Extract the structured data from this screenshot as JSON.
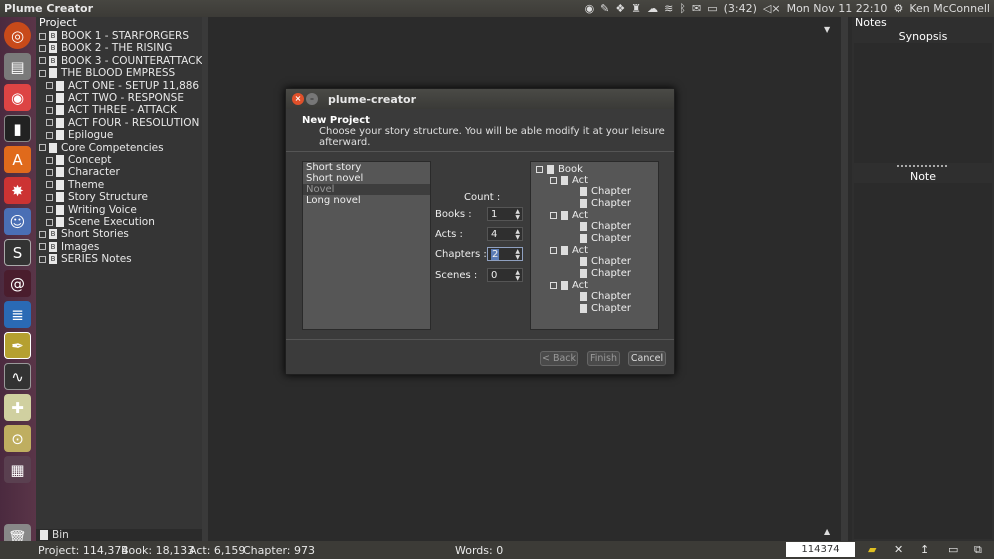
{
  "app_title": "Plume Creator",
  "tray": {
    "battery": "(3:42)",
    "datetime": "Mon Nov 11  22:10",
    "user": "Ken McConnell"
  },
  "project_panel": {
    "header": "Project",
    "items": [
      {
        "label": "BOOK 1 - STARFORGERS",
        "icon": "B",
        "indent": 0
      },
      {
        "label": "BOOK 2 - THE RISING",
        "icon": "B",
        "indent": 0
      },
      {
        "label": "BOOK 3 - COUNTERATTACK",
        "icon": "B",
        "indent": 0
      },
      {
        "label": "THE BLOOD EMPRESS",
        "icon": "book",
        "indent": 0
      },
      {
        "label": "ACT ONE - SETUP 11,886",
        "icon": "act",
        "indent": 1
      },
      {
        "label": "ACT TWO - RESPONSE",
        "icon": "act",
        "indent": 1
      },
      {
        "label": "ACT THREE - ATTACK",
        "icon": "act",
        "indent": 1
      },
      {
        "label": "ACT FOUR - RESOLUTION",
        "icon": "act",
        "indent": 1
      },
      {
        "label": "Epilogue",
        "icon": "act",
        "indent": 1
      },
      {
        "label": "Core Competencies",
        "icon": "book",
        "indent": 0
      },
      {
        "label": "Concept",
        "icon": "act",
        "indent": 1
      },
      {
        "label": "Character",
        "icon": "act",
        "indent": 1
      },
      {
        "label": "Theme",
        "icon": "act",
        "indent": 1
      },
      {
        "label": "Story Structure",
        "icon": "act",
        "indent": 1
      },
      {
        "label": "Writing Voice",
        "icon": "act",
        "indent": 1
      },
      {
        "label": "Scene Execution",
        "icon": "act",
        "indent": 1
      },
      {
        "label": "Short Stories",
        "icon": "B",
        "indent": 0
      },
      {
        "label": "Images",
        "icon": "B",
        "indent": 0
      },
      {
        "label": "SERIES Notes",
        "icon": "B",
        "indent": 0
      }
    ],
    "bin": "Bin"
  },
  "notes_panel": {
    "header": "Notes",
    "synopsis": "Synopsis",
    "note": "Note"
  },
  "status": {
    "project": "Project: 114,374",
    "book": "Book: 18,133",
    "act": "Act: 6,159",
    "chapter": "Chapter: 973",
    "words": "Words: 0",
    "counter": "114374"
  },
  "dialog": {
    "title": "plume-creator",
    "heading": "New Project",
    "subtext": "Choose your story structure. You will be able modify it at your leisure afterward.",
    "structures": [
      "Short story",
      "Short novel",
      "Novel",
      "Long novel"
    ],
    "selected_structure": "Novel",
    "count_label": "Count :",
    "fields": [
      {
        "label": "Books :",
        "value": "1"
      },
      {
        "label": "Acts :",
        "value": "4"
      },
      {
        "label": "Chapters :",
        "value": "2"
      },
      {
        "label": "Scenes :",
        "value": "0"
      }
    ],
    "preview": {
      "book": "Book",
      "acts": [
        {
          "label": "Act",
          "chapters": [
            "Chapter",
            "Chapter"
          ]
        },
        {
          "label": "Act",
          "chapters": [
            "Chapter",
            "Chapter"
          ]
        },
        {
          "label": "Act",
          "chapters": [
            "Chapter",
            "Chapter"
          ]
        },
        {
          "label": "Act",
          "chapters": [
            "Chapter",
            "Chapter"
          ]
        }
      ]
    },
    "buttons": {
      "back": "< Back",
      "finish": "Finish",
      "cancel": "Cancel"
    }
  }
}
